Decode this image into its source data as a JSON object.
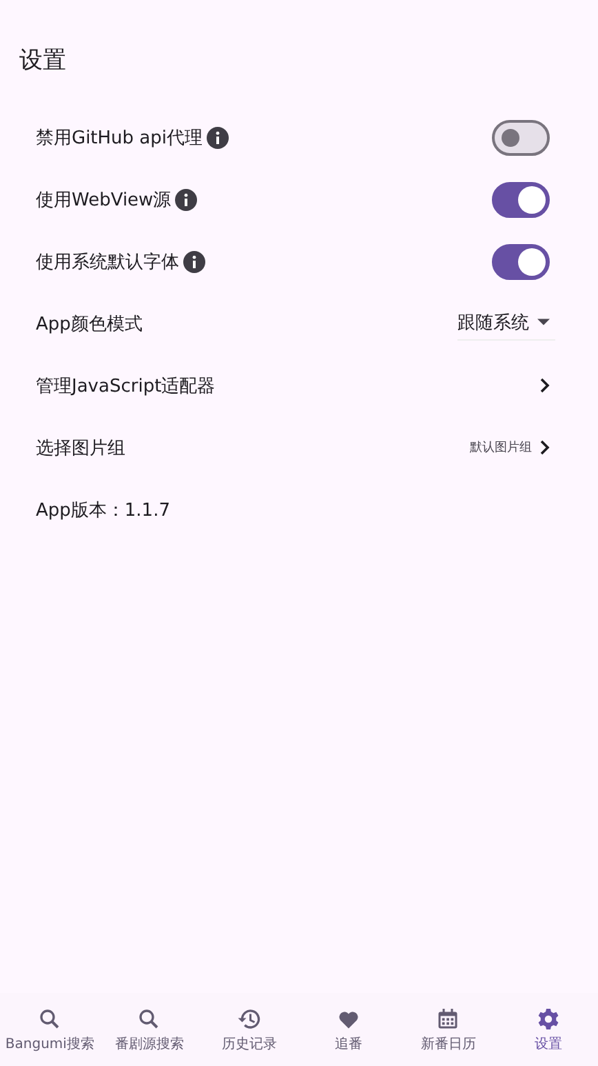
{
  "title": "设置",
  "settings": [
    {
      "kind": "switch",
      "label": "禁用GitHub api代理",
      "info": true,
      "on": false
    },
    {
      "kind": "switch",
      "label": "使用WebView源",
      "info": true,
      "on": true
    },
    {
      "kind": "switch",
      "label": "使用系统默认字体",
      "info": true,
      "on": true
    },
    {
      "kind": "dropdown",
      "label": "App颜色模式",
      "value": "跟随系统"
    },
    {
      "kind": "link",
      "label": "管理JavaScript适配器"
    },
    {
      "kind": "link",
      "label": "选择图片组",
      "value": "默认图片组"
    },
    {
      "kind": "text",
      "label": "App版本：1.1.7"
    }
  ],
  "nav": [
    {
      "label": "Bangumi搜索",
      "selected": false
    },
    {
      "label": "番剧源搜索",
      "selected": false
    },
    {
      "label": "历史记录",
      "selected": false
    },
    {
      "label": "追番",
      "selected": false
    },
    {
      "label": "新番日历",
      "selected": false
    },
    {
      "label": "设置",
      "selected": true
    }
  ]
}
